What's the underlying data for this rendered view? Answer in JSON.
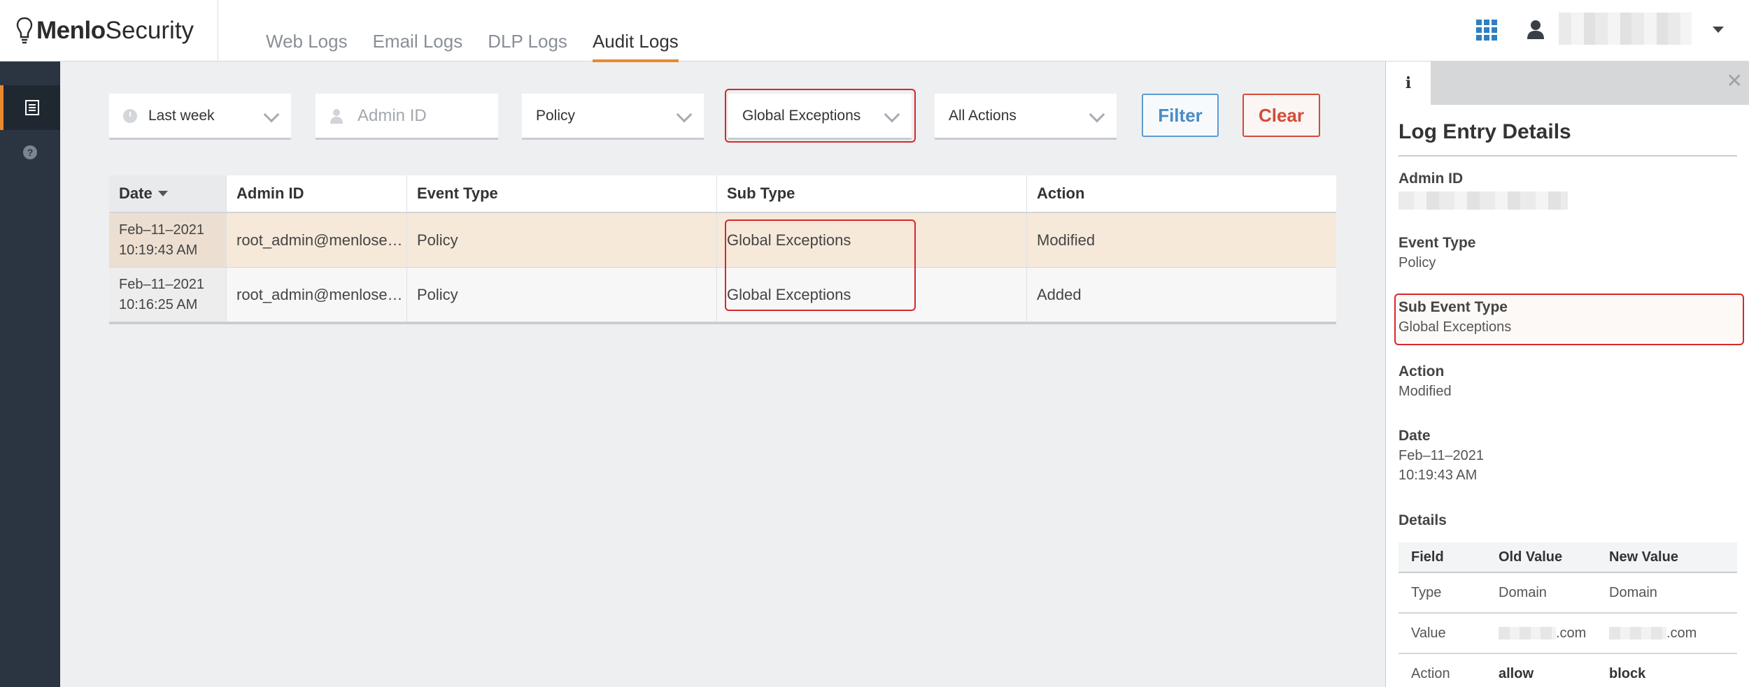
{
  "brand": {
    "name_bold": "Menlo",
    "name_regular": "Security"
  },
  "nav": {
    "tabs": [
      {
        "label": "Web Logs",
        "active": false
      },
      {
        "label": "Email Logs",
        "active": false
      },
      {
        "label": "DLP Logs",
        "active": false
      },
      {
        "label": "Audit Logs",
        "active": true
      }
    ]
  },
  "header": {
    "apps_icon": "grid-icon",
    "user_icon": "user-icon"
  },
  "filters": {
    "time_range": "Last week",
    "admin_id_placeholder": "Admin ID",
    "event_type": "Policy",
    "sub_type": "Global Exceptions",
    "actions": "All Actions",
    "filter_label": "Filter",
    "clear_label": "Clear"
  },
  "table": {
    "headers": [
      "Date",
      "Admin ID",
      "Event Type",
      "Sub Type",
      "Action"
    ],
    "rows": [
      {
        "date": "Feb–11–2021",
        "time": "10:19:43 AM",
        "admin": "root_admin@menlose…",
        "event": "Policy",
        "sub": "Global Exceptions",
        "action": "Modified"
      },
      {
        "date": "Feb–11–2021",
        "time": "10:16:25 AM",
        "admin": "root_admin@menlose…",
        "event": "Policy",
        "sub": "Global Exceptions",
        "action": "Added"
      }
    ]
  },
  "panel": {
    "title": "Log Entry Details",
    "admin_label": "Admin ID",
    "event_label": "Event Type",
    "event_value": "Policy",
    "sub_label": "Sub Event Type",
    "sub_value": "Global Exceptions",
    "action_label": "Action",
    "action_value": "Modified",
    "date_label": "Date",
    "date_value": "Feb–11–2021",
    "time_value": "10:19:43 AM",
    "details_label": "Details",
    "details": {
      "headers": [
        "Field",
        "Old Value",
        "New Value"
      ],
      "rows": [
        {
          "field": "Type",
          "old": "Domain",
          "new": "Domain"
        },
        {
          "field": "Value",
          "old": ".com",
          "new": ".com"
        },
        {
          "field": "Action",
          "old": "allow",
          "new": "block"
        }
      ]
    }
  },
  "colors": {
    "accent": "#e8892f",
    "highlight": "#d6282b",
    "sidebar": "#2b3541",
    "filter_button": "#4a8bc6",
    "clear_button": "#d24c38"
  }
}
